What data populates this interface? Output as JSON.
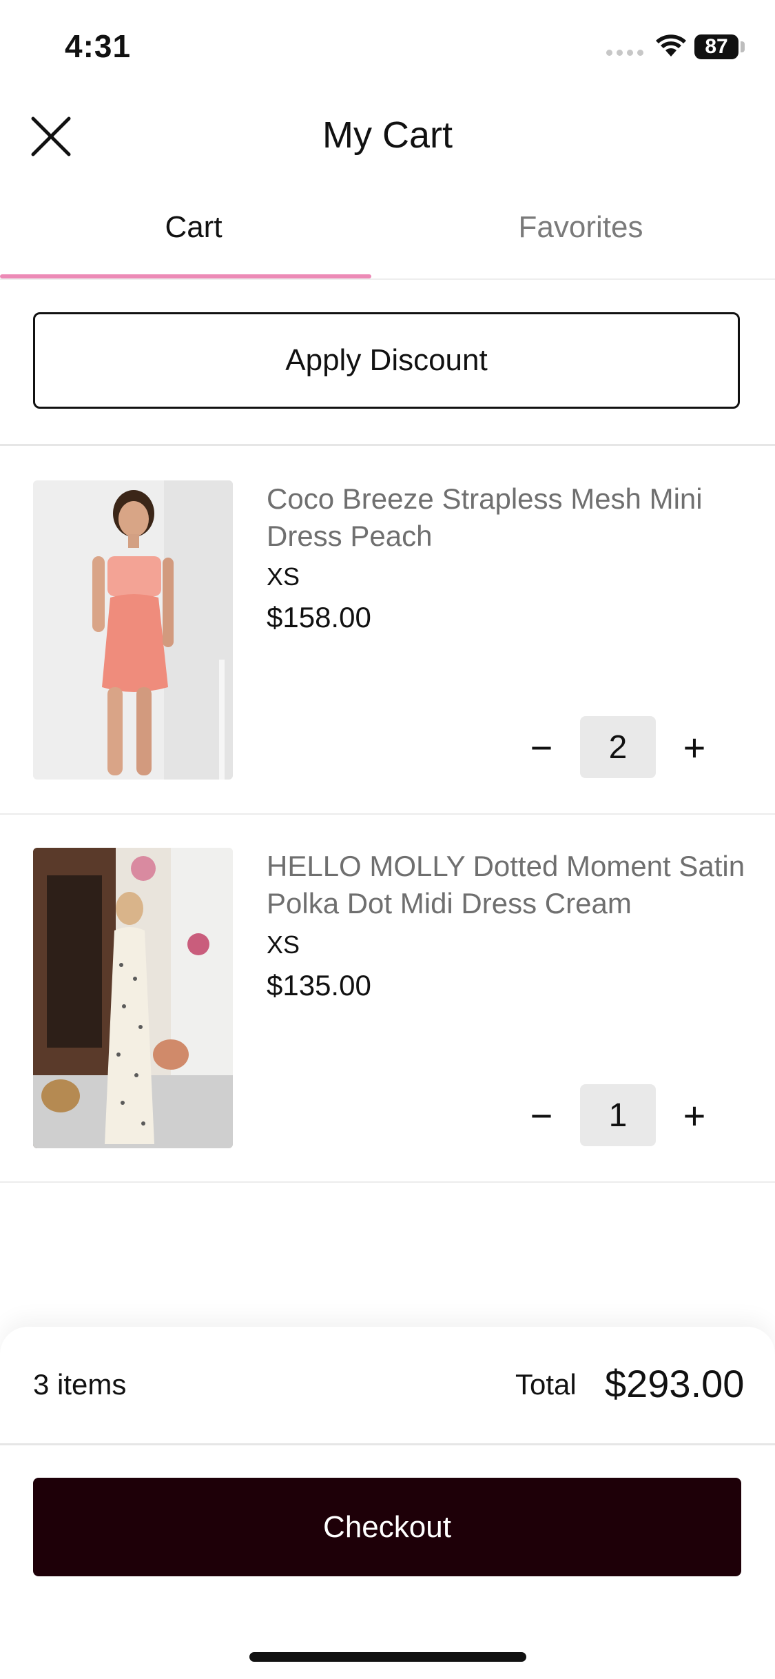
{
  "status_bar": {
    "time": "4:31",
    "battery": "87"
  },
  "header": {
    "title": "My Cart",
    "close_icon": "close-icon"
  },
  "tabs": [
    {
      "label": "Cart",
      "active": true
    },
    {
      "label": "Favorites",
      "active": false
    }
  ],
  "accent_color": "#ec8ab6",
  "discount": {
    "label": "Apply Discount"
  },
  "items": [
    {
      "name": "Coco Breeze Strapless Mesh Mini Dress Peach",
      "size": "XS",
      "price": "$158.00",
      "quantity": "2",
      "minus": "−",
      "plus": "+"
    },
    {
      "name": "HELLO MOLLY Dotted Moment Satin Polka Dot Midi Dress Cream",
      "size": "XS",
      "price": "$135.00",
      "quantity": "1",
      "minus": "−",
      "plus": "+"
    }
  ],
  "summary": {
    "items_count": "3 items",
    "total_label": "Total",
    "total_value": "$293.00"
  },
  "checkout": {
    "label": "Checkout",
    "color": "#1e0008"
  }
}
